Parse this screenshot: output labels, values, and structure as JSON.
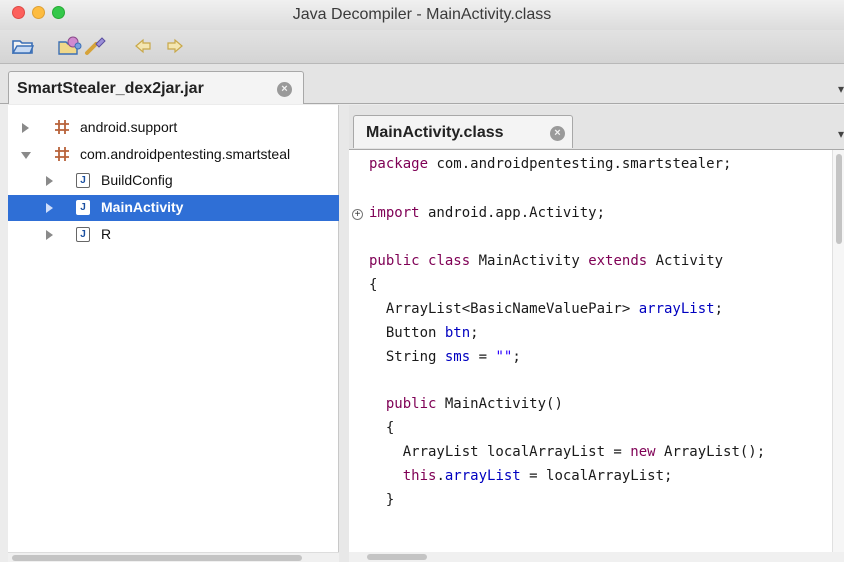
{
  "window": {
    "title": "Java Decompiler - MainActivity.class"
  },
  "colors": {
    "selection": "#2f6fd6",
    "keyword": "#7f0055",
    "field": "#0000c0",
    "string": "#2a00ff"
  },
  "toolbar": {
    "icons": [
      "open-folder-icon",
      "open-recent-icon",
      "search-icon",
      "back-arrow-icon",
      "forward-arrow-icon"
    ]
  },
  "jar_tab": {
    "label": "SmartStealer_dex2jar.jar"
  },
  "overflow_glyph": "▾",
  "tree": {
    "items": [
      {
        "label": "android.support",
        "kind": "package"
      },
      {
        "label": "com.androidpentesting.smartsteal",
        "kind": "package"
      },
      {
        "label": "BuildConfig",
        "kind": "class"
      },
      {
        "label": "MainActivity",
        "kind": "class",
        "selected": true
      },
      {
        "label": "R",
        "kind": "class"
      }
    ],
    "class_glyph": "J"
  },
  "editor": {
    "tab_label": "MainActivity.class",
    "fold_glyph": "+",
    "lines": [
      [
        {
          "t": "package",
          "c": "kw"
        },
        {
          "t": " com.androidpentesting.smartstealer;"
        }
      ],
      [
        {
          "t": "import",
          "c": "kw"
        },
        {
          "t": " android.app.Activity;"
        }
      ],
      [
        {
          "t": "public",
          "c": "kw"
        },
        {
          "t": " "
        },
        {
          "t": "class",
          "c": "kw"
        },
        {
          "t": " MainActivity "
        },
        {
          "t": "extends",
          "c": "kw"
        },
        {
          "t": " Activity"
        }
      ],
      [
        {
          "t": "{"
        }
      ],
      [
        {
          "t": "  ArrayList<BasicNameValuePair> "
        },
        {
          "t": "arrayList",
          "c": "fld"
        },
        {
          "t": ";"
        }
      ],
      [
        {
          "t": "  Button "
        },
        {
          "t": "btn",
          "c": "fld"
        },
        {
          "t": ";"
        }
      ],
      [
        {
          "t": "  String "
        },
        {
          "t": "sms",
          "c": "fld"
        },
        {
          "t": " = "
        },
        {
          "t": "\"\"",
          "c": "str"
        },
        {
          "t": ";"
        }
      ],
      [
        {
          "t": "  "
        },
        {
          "t": "public",
          "c": "kw"
        },
        {
          "t": " MainActivity()"
        }
      ],
      [
        {
          "t": "  {"
        }
      ],
      [
        {
          "t": "    ArrayList localArrayList = "
        },
        {
          "t": "new",
          "c": "kw"
        },
        {
          "t": " ArrayList();"
        }
      ],
      [
        {
          "t": "    "
        },
        {
          "t": "this",
          "c": "kw"
        },
        {
          "t": "."
        },
        {
          "t": "arrayList",
          "c": "fld"
        },
        {
          "t": " = localArrayList;"
        }
      ],
      [
        {
          "t": "  }"
        }
      ]
    ]
  }
}
